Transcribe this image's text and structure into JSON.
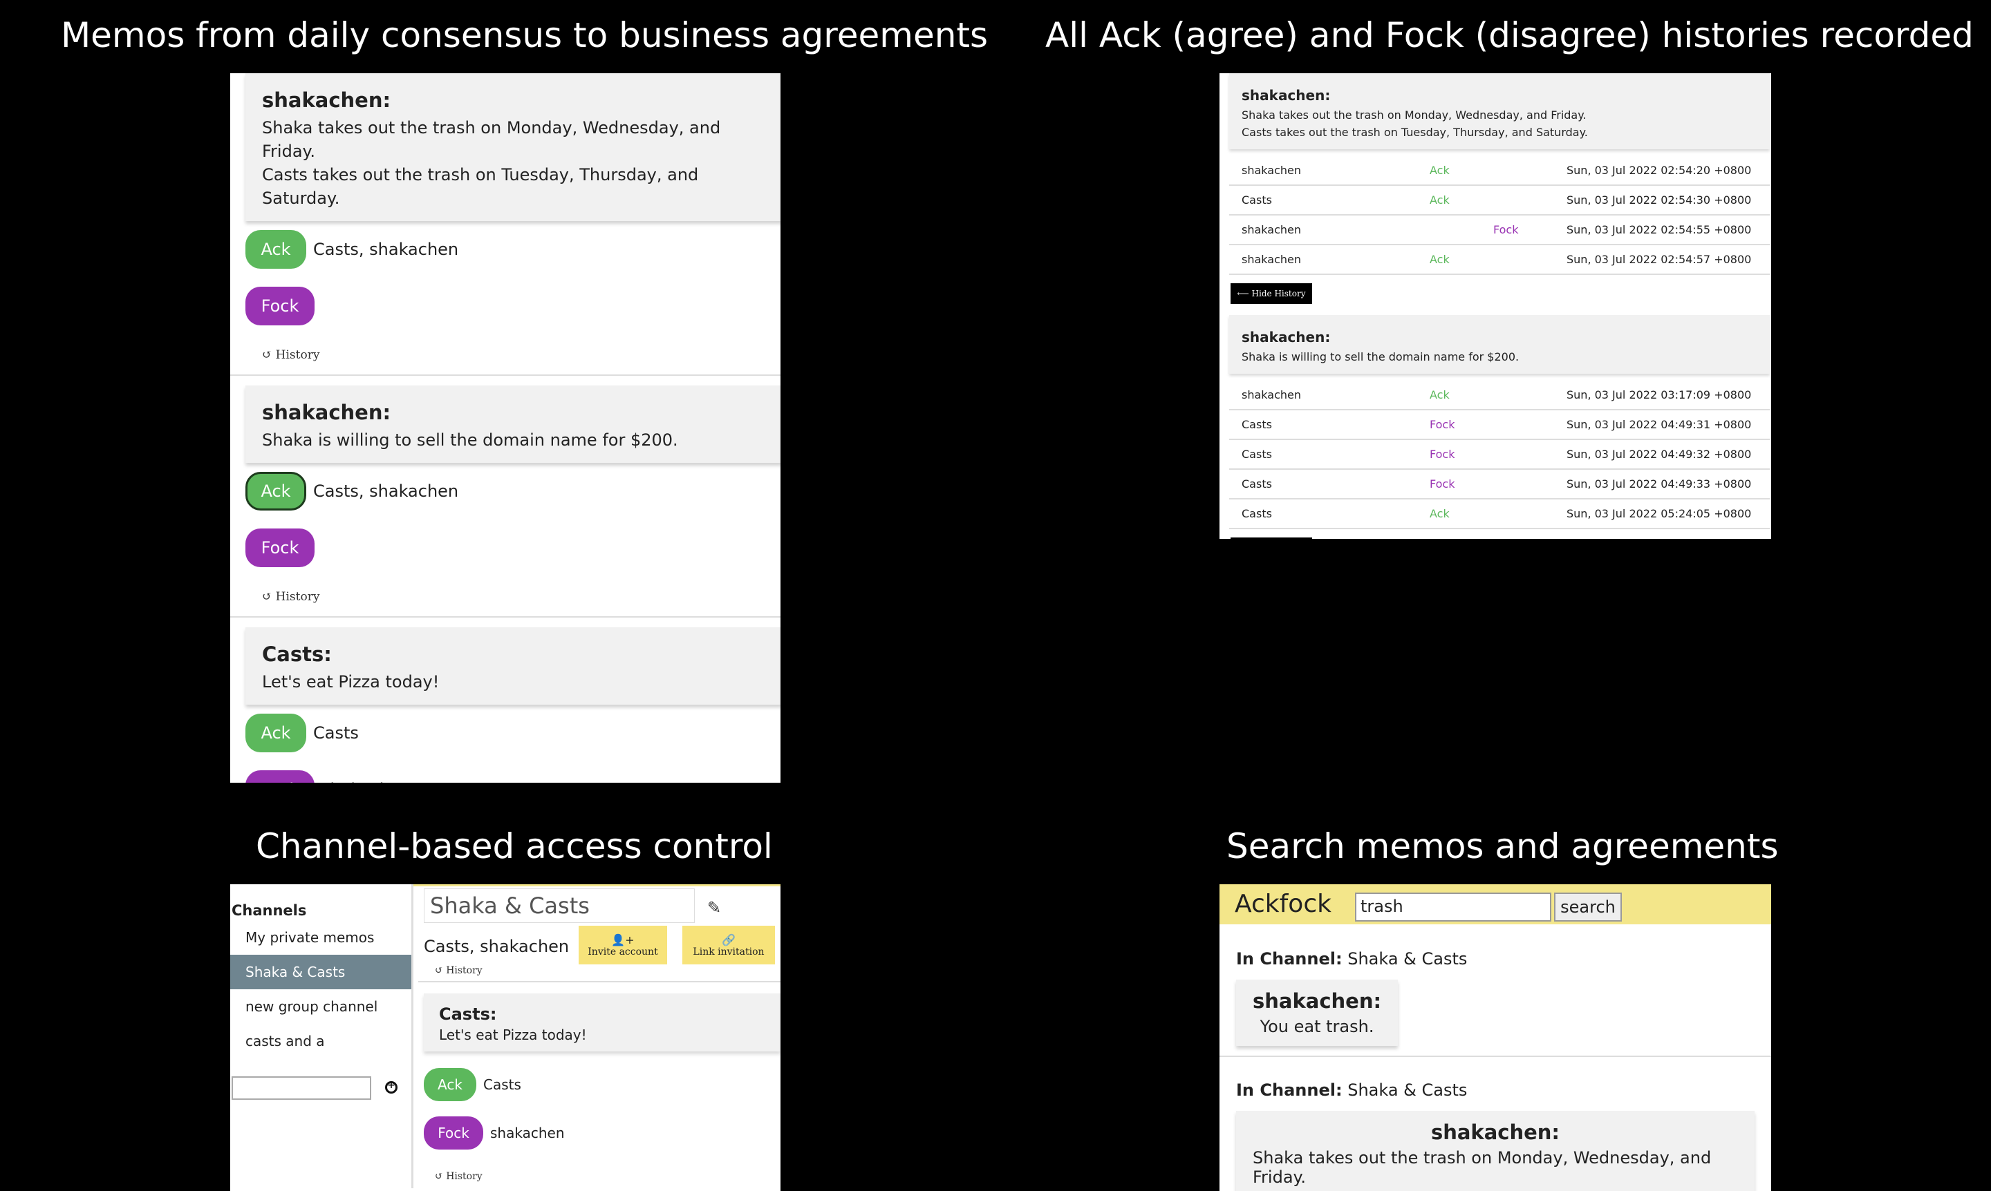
{
  "captions": {
    "memos": "Memos from daily consensus to business agreements",
    "histories": "All Ack (agree) and Fock (disagree) histories recorded",
    "channels": "Channel-based access control",
    "search": "Search memos and agreements"
  },
  "memos_panel": {
    "ack_label": "Ack",
    "fock_label": "Fock",
    "history_label": "History",
    "memos": [
      {
        "author": "shakachen:",
        "lines": [
          "Shaka takes out the trash on Monday, Wednesday, and Friday.",
          "Casts takes out the trash on Tuesday, Thursday, and Saturday."
        ],
        "ack_voters": "Casts, shakachen",
        "fock_voters": ""
      },
      {
        "author": "shakachen:",
        "lines": [
          "Shaka is willing to sell the domain name for $200."
        ],
        "ack_voters": "Casts, shakachen",
        "fock_voters": ""
      },
      {
        "author": "Casts:",
        "lines": [
          "Let's eat Pizza today!"
        ],
        "ack_voters": "Casts",
        "fock_voters": "shakachen"
      }
    ]
  },
  "histories_panel": {
    "hide_label": "Hide History",
    "memos": [
      {
        "author": "shakachen:",
        "lines": [
          "Shaka takes out the trash on Monday, Wednesday, and Friday.",
          "Casts takes out the trash on Tuesday, Thursday, and Saturday."
        ],
        "rows": [
          {
            "user": "shakachen",
            "vote": "Ack",
            "time": "Sun, 03 Jul 2022 02:54:20 +0800"
          },
          {
            "user": "Casts",
            "vote": "Ack",
            "time": "Sun, 03 Jul 2022 02:54:30 +0800"
          },
          {
            "user": "shakachen",
            "vote": "Fock",
            "time": "Sun, 03 Jul 2022 02:54:55 +0800"
          },
          {
            "user": "shakachen",
            "vote": "Ack",
            "time": "Sun, 03 Jul 2022 02:54:57 +0800"
          }
        ]
      },
      {
        "author": "shakachen:",
        "lines": [
          "Shaka is willing to sell the domain name for $200."
        ],
        "rows": [
          {
            "user": "shakachen",
            "vote": "Ack",
            "time": "Sun, 03 Jul 2022 03:17:09 +0800"
          },
          {
            "user": "Casts",
            "vote": "Fock",
            "time": "Sun, 03 Jul 2022 04:49:31 +0800"
          },
          {
            "user": "Casts",
            "vote": "Fock",
            "time": "Sun, 03 Jul 2022 04:49:32 +0800"
          },
          {
            "user": "Casts",
            "vote": "Fock",
            "time": "Sun, 03 Jul 2022 04:49:33 +0800"
          },
          {
            "user": "Casts",
            "vote": "Ack",
            "time": "Sun, 03 Jul 2022 05:24:05 +0800"
          }
        ]
      }
    ]
  },
  "channels_panel": {
    "sidebar_title": "Channels",
    "channels": [
      "My private memos",
      "Shaka & Casts",
      "new group channel",
      "casts and a"
    ],
    "active_channel": "Shaka & Casts",
    "channel_title": "Shaka & Casts",
    "members": "Casts, shakachen",
    "invite_label": "Invite account",
    "link_label": "Link invitation",
    "history_label": "History",
    "memo_author": "Casts:",
    "memo_text": "Let's eat Pizza today!",
    "ack_label": "Ack",
    "fock_label": "Fock",
    "ack_voters": "Casts",
    "fock_voters": "shakachen"
  },
  "search_panel": {
    "brand": "Ackfock",
    "query": "trash",
    "search_label": "search",
    "in_channel_label": "In Channel",
    "results": [
      {
        "channel": "Shaka & Casts",
        "author": "shakachen:",
        "text": "You eat trash."
      },
      {
        "channel": "Shaka & Casts",
        "author": "shakachen:",
        "text": "Shaka takes out the trash on Monday, Wednesday, and Friday."
      }
    ]
  },
  "colors": {
    "ack": "#5cb85c",
    "fock": "#9933b3",
    "accent_bar": "#f3e68a",
    "active_channel": "#6f8590"
  }
}
